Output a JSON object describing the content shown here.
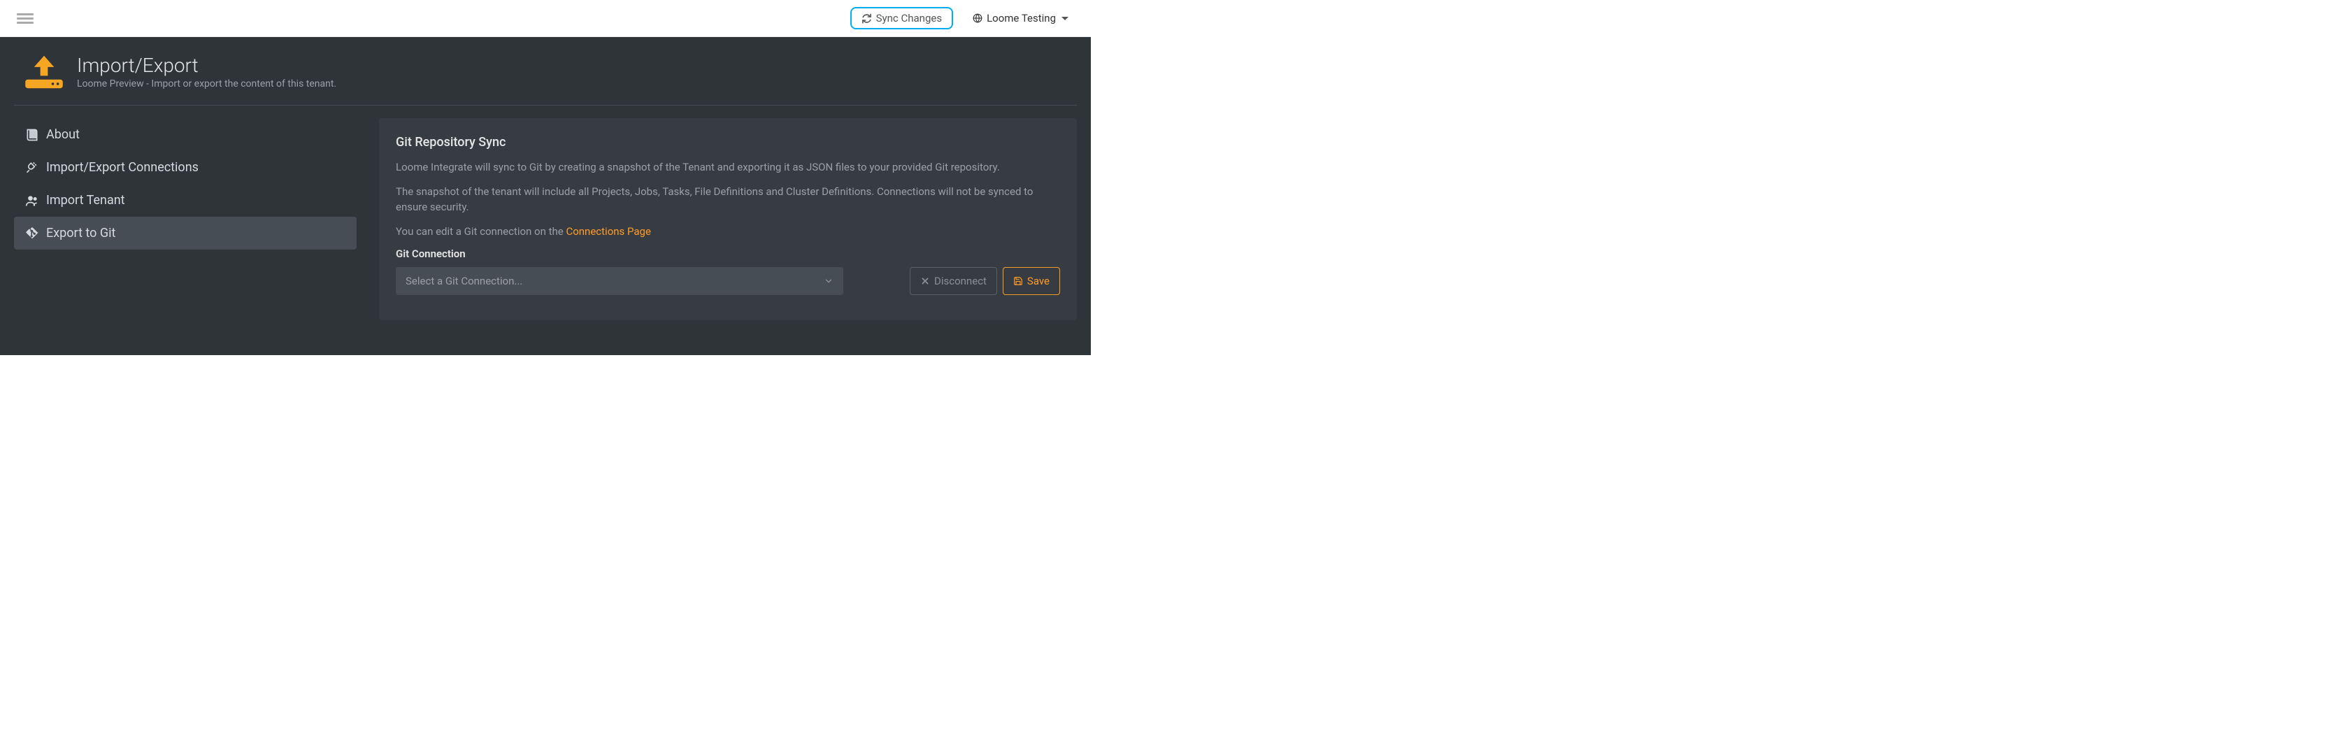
{
  "topbar": {
    "sync_label": "Sync Changes",
    "tenant_label": "Loome Testing"
  },
  "header": {
    "title": "Import/Export",
    "subtitle": "Loome Preview - Import or export the content of this tenant."
  },
  "sidebar": {
    "items": [
      {
        "label": "About"
      },
      {
        "label": "Import/Export Connections"
      },
      {
        "label": "Import Tenant"
      },
      {
        "label": "Export to Git"
      }
    ]
  },
  "panel": {
    "title": "Git Repository Sync",
    "p1": "Loome Integrate will sync to Git by creating a snapshot of the Tenant and exporting it as JSON files to your provided Git repository.",
    "p2": "The snapshot of the tenant will include all Projects, Jobs, Tasks, File Definitions and Cluster Definitions. Connections will not be synced to ensure security.",
    "p3_prefix": "You can edit a Git connection on the ",
    "p3_link": "Connections Page",
    "git_connection_label": "Git Connection",
    "select_placeholder": "Select a Git Connection...",
    "disconnect_label": "Disconnect",
    "save_label": "Save"
  }
}
